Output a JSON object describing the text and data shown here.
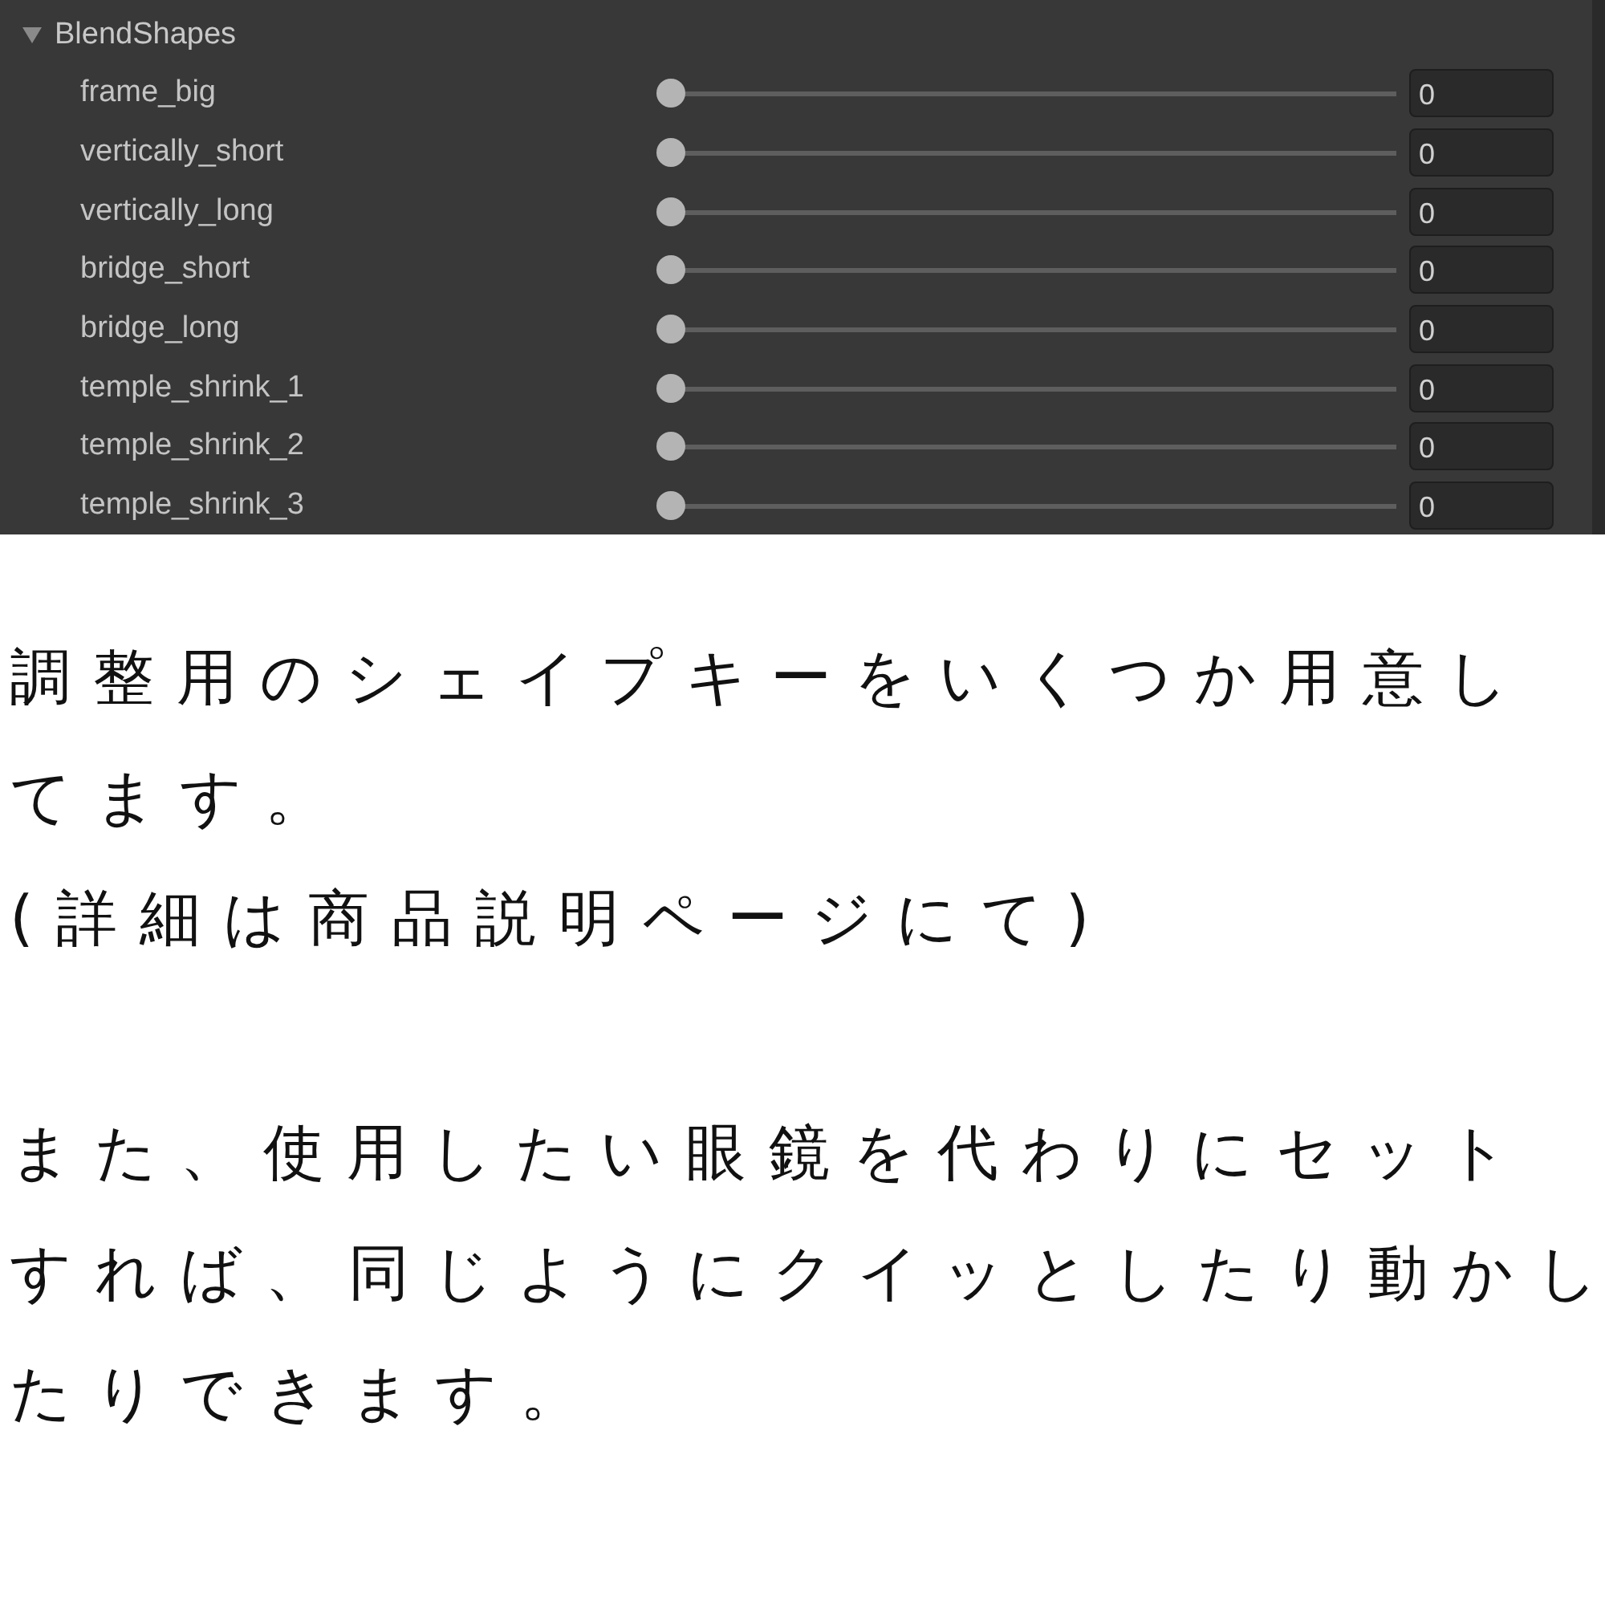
{
  "inspector": {
    "section": {
      "title": "BlendShapes",
      "expanded": true,
      "rows": [
        {
          "name": "frame_big",
          "level": 0,
          "value": "0"
        },
        {
          "name": "vertically_short",
          "level": 0,
          "value": "0"
        },
        {
          "name": "vertically_long",
          "level": 0,
          "value": "0"
        },
        {
          "name": "bridge_short",
          "level": 0,
          "value": "0"
        },
        {
          "name": "bridge_long",
          "level": 0,
          "value": "0"
        },
        {
          "name": "temple_shrink_1",
          "level": 0,
          "value": "0"
        },
        {
          "name": "temple_shrink_2",
          "level": 0,
          "value": "0"
        },
        {
          "name": "temple_shrink_3",
          "level": 0,
          "value": "0"
        }
      ]
    }
  },
  "caption": {
    "paragraphs": [
      [
        "調整用のシェイプキーをいくつか用意し",
        "てます。",
        "(詳細は商品説明ページにて)"
      ],
      [
        "また、使用したい眼鏡を代わりにセット",
        "すれば、同じようにクイッとしたり動かし",
        "たりできます。"
      ]
    ]
  }
}
